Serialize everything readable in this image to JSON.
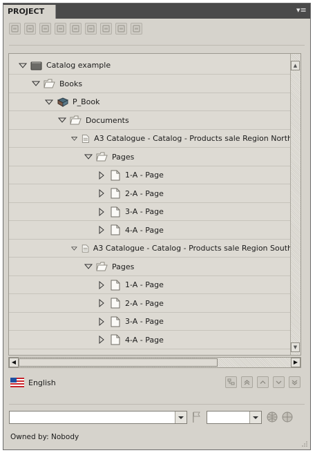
{
  "panel": {
    "tab_label": "PROJECT",
    "menu_icon": "panel-menu-icon"
  },
  "toolbar": {
    "buttons": [
      "new-catalog-icon",
      "save-icon",
      "properties-icon",
      "add-icon",
      "duplicate-icon",
      "delete-icon",
      "document-icon",
      "layout-icon",
      "refresh-icon"
    ]
  },
  "tree": {
    "nodes": [
      {
        "label": "Catalog example",
        "icon": "catalog-icon",
        "expanded": true,
        "level": 0
      },
      {
        "label": "Books",
        "icon": "folder-icon",
        "expanded": true,
        "level": 1
      },
      {
        "label": "P_Book",
        "icon": "book-icon",
        "expanded": true,
        "level": 2
      },
      {
        "label": "Documents",
        "icon": "folder-icon",
        "expanded": true,
        "level": 3
      },
      {
        "label": "A3 Catalogue - Catalog - Products sale Region North",
        "icon": "document-icon",
        "expanded": true,
        "level": 4
      },
      {
        "label": "Pages",
        "icon": "folder-icon",
        "expanded": true,
        "level": 5
      },
      {
        "label": "1-A - Page",
        "icon": "page-icon",
        "expanded": false,
        "level": 6
      },
      {
        "label": "2-A - Page",
        "icon": "page-icon",
        "expanded": false,
        "level": 6
      },
      {
        "label": "3-A - Page",
        "icon": "page-icon",
        "expanded": false,
        "level": 6
      },
      {
        "label": "4-A - Page",
        "icon": "page-icon",
        "expanded": false,
        "level": 6
      },
      {
        "label": "A3 Catalogue - Catalog - Products sale Region South",
        "icon": "document-icon",
        "expanded": true,
        "level": 4
      },
      {
        "label": "Pages",
        "icon": "folder-icon",
        "expanded": true,
        "level": 5
      },
      {
        "label": "1-A - Page",
        "icon": "page-icon",
        "expanded": false,
        "level": 6
      },
      {
        "label": "2-A - Page",
        "icon": "page-icon",
        "expanded": false,
        "level": 6
      },
      {
        "label": "3-A - Page",
        "icon": "page-icon",
        "expanded": false,
        "level": 6
      },
      {
        "label": "4-A - Page",
        "icon": "page-icon",
        "expanded": false,
        "level": 6
      }
    ]
  },
  "language": {
    "label": "English",
    "flag_icon": "us-flag-icon"
  },
  "nav_buttons": [
    "tree-view-icon",
    "first-icon",
    "previous-icon",
    "next-icon",
    "last-icon"
  ],
  "filters": {
    "primary_value": "",
    "secondary_value": "",
    "flag_icon": "flag-icon",
    "action_icons": [
      "globe-lock-icon",
      "globe-icon"
    ]
  },
  "owner": {
    "text": "Owned by: Nobody"
  },
  "colors": {
    "panel_bg": "#d6d3cc",
    "tab_bar": "#4a4a4a",
    "accent_flag_blue": "#1f4fa0",
    "accent_flag_red": "#c8242b"
  }
}
